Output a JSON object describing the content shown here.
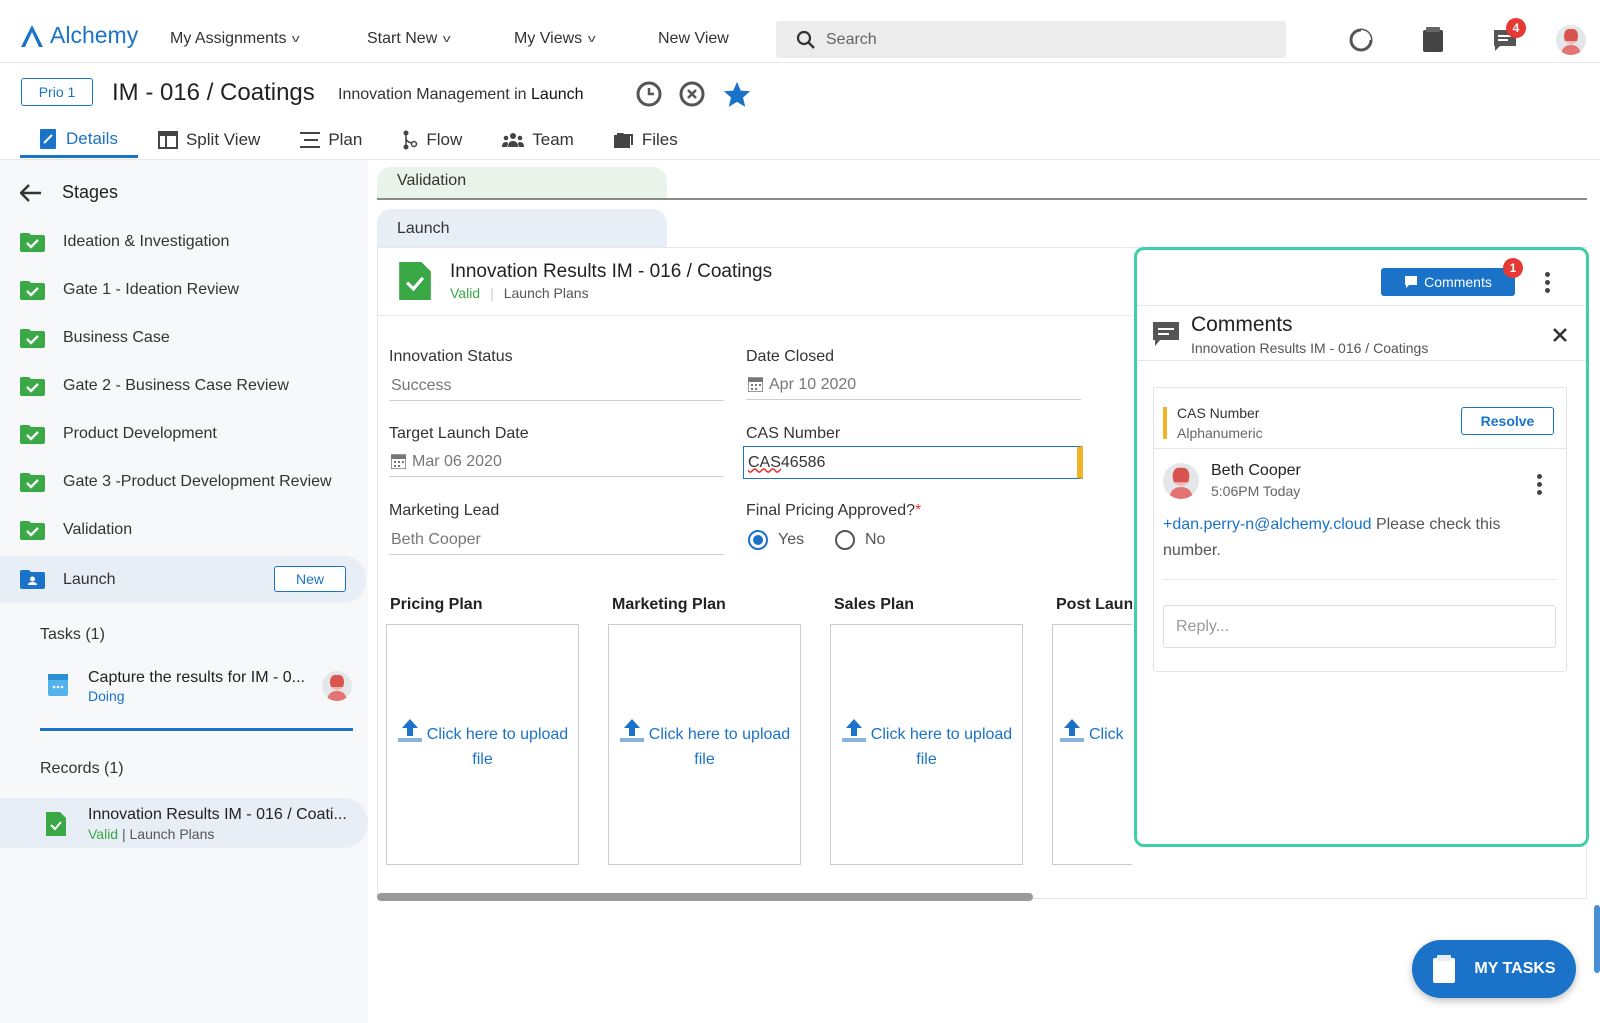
{
  "app": {
    "name": "Alchemy"
  },
  "nav": {
    "my_assignments": "My Assignments",
    "start_new": "Start New",
    "my_views": "My Views",
    "new_view": "New View",
    "search_placeholder": "Search",
    "messages_badge": "4"
  },
  "record": {
    "priority": "Prio 1",
    "title": "IM - 016 / Coatings",
    "subtitle_prefix": "Innovation Management in",
    "subtitle_stage": "Launch"
  },
  "tabs": [
    {
      "label": "Details"
    },
    {
      "label": "Split View"
    },
    {
      "label": "Plan"
    },
    {
      "label": "Flow"
    },
    {
      "label": "Team"
    },
    {
      "label": "Files"
    }
  ],
  "sidebar": {
    "title": "Stages",
    "stages": [
      {
        "label": "Ideation & Investigation"
      },
      {
        "label": "Gate 1 - Ideation Review"
      },
      {
        "label": "Business Case"
      },
      {
        "label": "Gate 2 - Business Case Review"
      },
      {
        "label": "Product Development"
      },
      {
        "label": "Gate 3 -Product Development Review"
      },
      {
        "label": "Validation"
      },
      {
        "label": "Launch",
        "badge": "New"
      }
    ],
    "tasks_header": "Tasks (1)",
    "task": {
      "title": "Capture the results for IM - 0...",
      "status": "Doing"
    },
    "records_header": "Records (1)",
    "record_item": {
      "title": "Innovation Results IM - 016 / Coati...",
      "status": "Valid",
      "sub": "| Launch Plans"
    }
  },
  "stage_tabs": {
    "validation": "Validation",
    "launch": "Launch"
  },
  "form": {
    "title": "Innovation Results IM - 016 / Coatings",
    "status": "Valid",
    "sub": "Launch Plans",
    "innovation_status_label": "Innovation Status",
    "innovation_status_value": "Success",
    "date_closed_label": "Date Closed",
    "date_closed_value": "Apr 10 2020",
    "target_launch_label": "Target Launch Date",
    "target_launch_value": "Mar 06 2020",
    "cas_label": "CAS Number",
    "cas_value_a": "CAS",
    "cas_value_b": " 46586",
    "marketing_lead_label": "Marketing Lead",
    "marketing_lead_value": "Beth Cooper",
    "final_pricing_label": "Final Pricing Approved?",
    "required_mark": "*",
    "yes": "Yes",
    "no": "No",
    "plans": [
      {
        "title": "Pricing Plan"
      },
      {
        "title": "Marketing Plan"
      },
      {
        "title": "Sales Plan"
      },
      {
        "title": "Post Laun"
      }
    ],
    "upload_text_1": "Click here to upload",
    "upload_text_2": "file",
    "upload_text_partial": "Click"
  },
  "comments": {
    "button": "Comments",
    "button_badge": "1",
    "title": "Comments",
    "subtitle": "Innovation Results IM - 016 / Coatings",
    "field_name": "CAS Number",
    "field_type": "Alphanumeric",
    "resolve": "Resolve",
    "author": "Beth Cooper",
    "time": "5:06PM Today",
    "mention": "+dan.perry-n@alchemy.cloud",
    "message_1": " Please check this",
    "message_2": "number.",
    "reply_placeholder": "Reply..."
  },
  "my_tasks": "MY TASKS",
  "colors": {
    "accent": "#1a73c8",
    "success": "#3aa845",
    "panel_border": "#3fcfa6",
    "badge": "#e53935"
  }
}
